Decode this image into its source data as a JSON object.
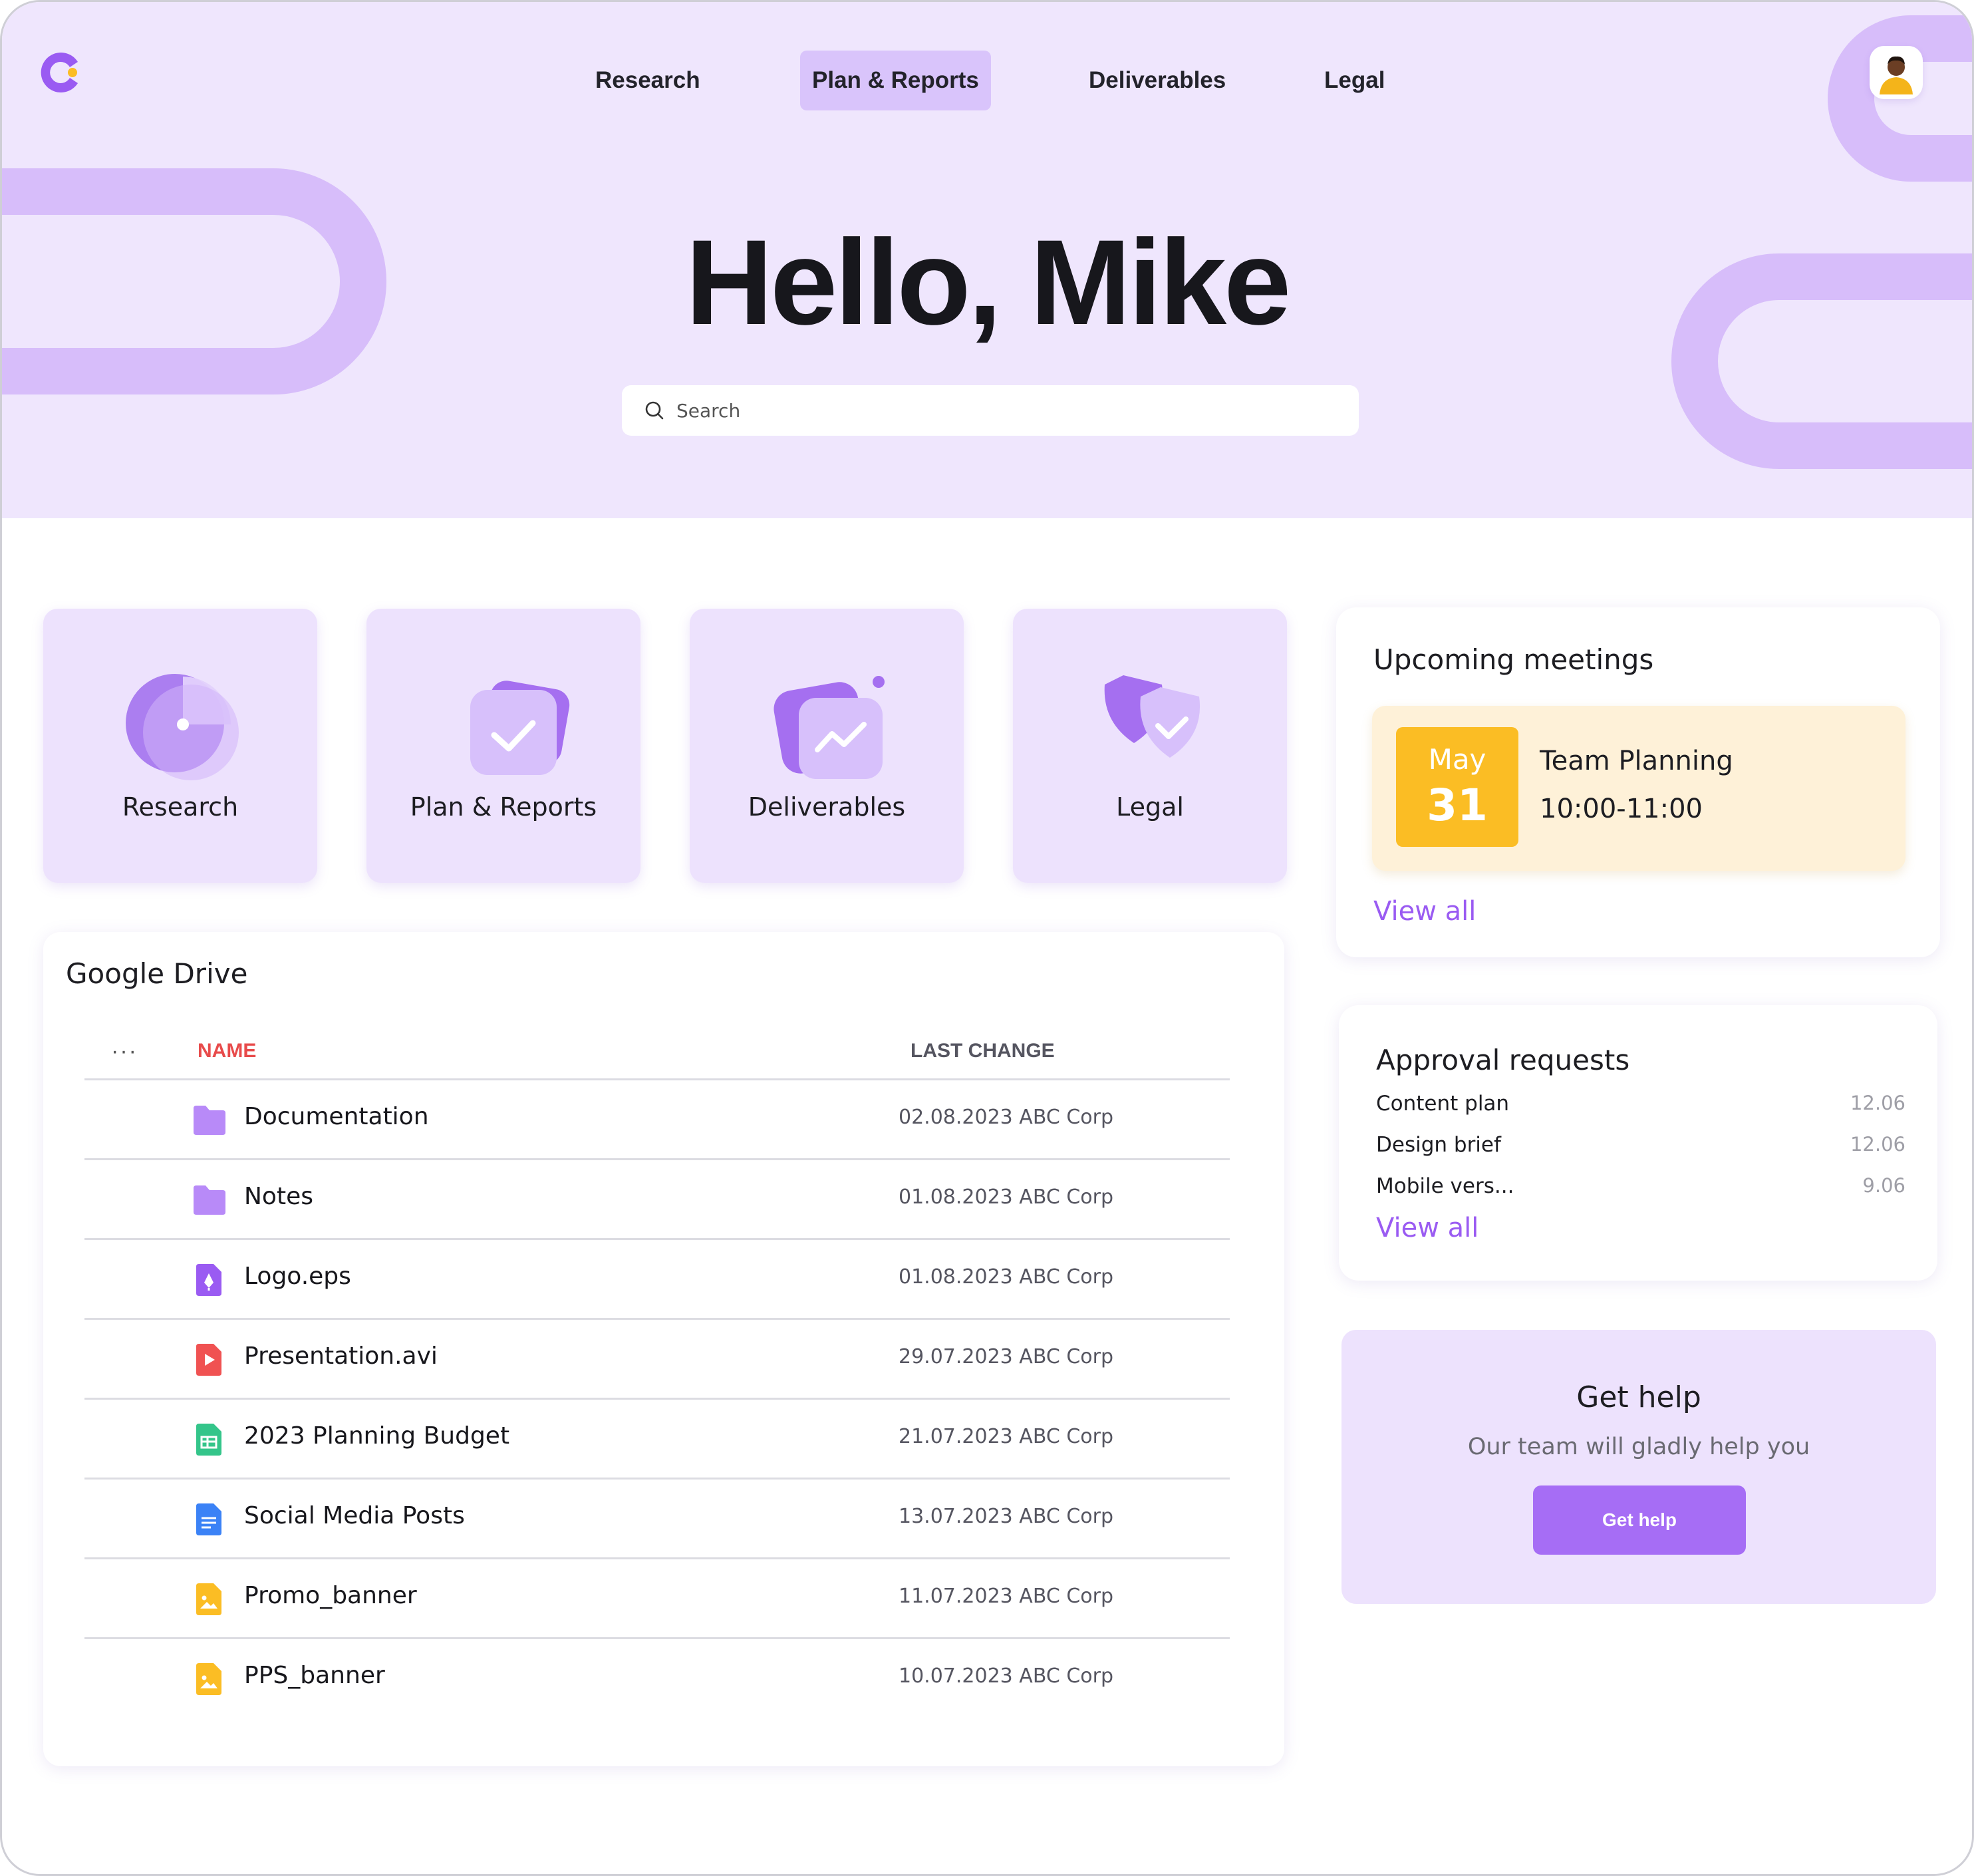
{
  "nav": {
    "items": [
      {
        "label": "Research"
      },
      {
        "label": "Plan & Reports"
      },
      {
        "label": "Deliverables"
      },
      {
        "label": "Legal"
      }
    ],
    "active_index": 1
  },
  "hero": {
    "greeting": "Hello, Mike",
    "search_placeholder": "Search"
  },
  "categories": [
    {
      "label": "Research",
      "icon": "pie-chart-icon"
    },
    {
      "label": "Plan & Reports",
      "icon": "checklist-icon"
    },
    {
      "label": "Deliverables",
      "icon": "trend-chart-icon"
    },
    {
      "label": "Legal",
      "icon": "shield-check-icon"
    }
  ],
  "drive": {
    "title": "Google Drive",
    "more_icon": "more-dots-icon",
    "columns": {
      "name": "NAME",
      "last_change": "LAST CHANGE"
    },
    "files": [
      {
        "name": "Documentation",
        "last_change": "02.08.2023 ABC Corp",
        "icon": "folder-icon"
      },
      {
        "name": "Notes",
        "last_change": "01.08.2023 ABC Corp",
        "icon": "folder-icon"
      },
      {
        "name": "Logo.eps",
        "last_change": "01.08.2023 ABC Corp",
        "icon": "vector-file-icon"
      },
      {
        "name": "Presentation.avi",
        "last_change": "29.07.2023 ABC Corp",
        "icon": "video-file-icon"
      },
      {
        "name": "2023 Planning Budget",
        "last_change": "21.07.2023 ABC Corp",
        "icon": "spreadsheet-file-icon"
      },
      {
        "name": "Social Media Posts",
        "last_change": "13.07.2023 ABC Corp",
        "icon": "document-file-icon"
      },
      {
        "name": "Promo_banner",
        "last_change": "11.07.2023 ABC Corp",
        "icon": "image-file-icon"
      },
      {
        "name": "PPS_banner",
        "last_change": "10.07.2023 ABC Corp",
        "icon": "image-file-icon"
      }
    ]
  },
  "meetings": {
    "title": "Upcoming meetings",
    "items": [
      {
        "month": "May",
        "day": "31",
        "title": "Team Planning",
        "time": "10:00-11:00"
      }
    ],
    "view_all": "View all"
  },
  "approvals": {
    "title": "Approval requests",
    "items": [
      {
        "name": "Content plan",
        "date": "12.06"
      },
      {
        "name": "Design brief",
        "date": "12.06"
      },
      {
        "name": "Mobile vers...",
        "date": "9.06"
      }
    ],
    "view_all": "View all"
  },
  "help": {
    "title": "Get help",
    "subtitle": "Our team will gladly help you",
    "button": "Get help"
  },
  "colors": {
    "accent": "#a66df5",
    "hero_bg": "#efe6fd",
    "card_bg": "#ede2fd",
    "meeting_badge": "#fbbd24",
    "meeting_card": "#fef1d8",
    "name_header": "#e84b4b"
  }
}
